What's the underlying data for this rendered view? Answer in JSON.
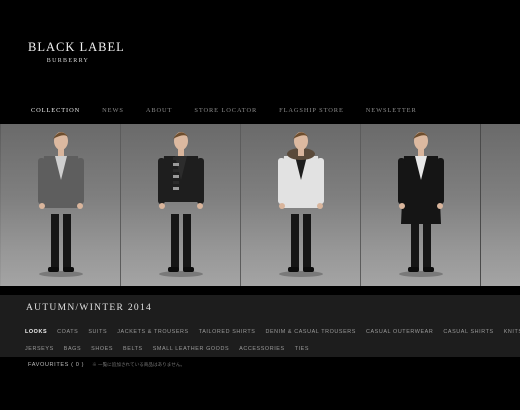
{
  "brand": {
    "name": "BLACK LABEL",
    "sub": "BURBERRY"
  },
  "nav": [
    {
      "label": "COLLECTION",
      "active": true
    },
    {
      "label": "NEWS"
    },
    {
      "label": "ABOUT"
    },
    {
      "label": "STORE LOCATOR"
    },
    {
      "label": "FLAGSHIP STORE"
    },
    {
      "label": "NEWSLETTER"
    }
  ],
  "looks": [
    {
      "coat_color": "#5e5e5e",
      "inner": "#cfcfcf",
      "scarf": "none"
    },
    {
      "coat_color": "#1e1e1e",
      "inner": "#2c2c2c",
      "scarf": "striped"
    },
    {
      "coat_color": "#e2e2e2",
      "inner": "#1d1d1d",
      "scarf": "fur"
    },
    {
      "coat_color": "#151515",
      "inner": "#e8e8e8",
      "scarf": "none"
    }
  ],
  "season": "AUTUMN/WINTER 2014",
  "categories": {
    "row1": [
      "LOOKS",
      "COATS",
      "SUITS",
      "JACKETS & TROUSERS",
      "TAILORED SHIRTS",
      "DENIM & CASUAL TROUSERS",
      "CASUAL OUTERWEAR",
      "CASUAL SHIRTS",
      "KNITS"
    ],
    "row2": [
      "JERSEYS",
      "BAGS",
      "SHOES",
      "BELTS",
      "SMALL LEATHER GOODS",
      "ACCESSORIES",
      "TIES"
    ],
    "active": "LOOKS"
  },
  "footer": {
    "favourites": "FAVOURITES ( 0 )",
    "note": "※ 一覧に追加されている商品はありません。"
  }
}
